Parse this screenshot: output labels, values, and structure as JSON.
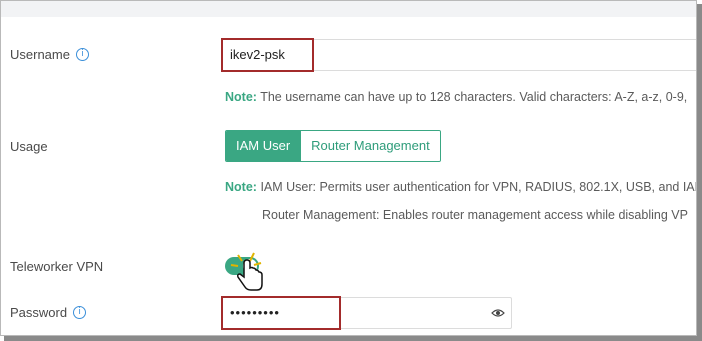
{
  "fields": {
    "username": {
      "label": "Username",
      "value": "ikev2-psk"
    },
    "username_note": {
      "prefix": "Note:",
      "text": "The username can have up to 128 characters. Valid characters: A-Z, a-z, 0-9,"
    },
    "usage": {
      "label": "Usage",
      "options": [
        "IAM User",
        "Router Management"
      ],
      "selected": "IAM User"
    },
    "usage_note": {
      "prefix": "Note:",
      "line1": "IAM User: Permits user authentication for VPN, RADIUS, 802.1X, USB, and IAM",
      "line2": "Router Management: Enables router management access while disabling VP"
    },
    "teleworker": {
      "label": "Teleworker VPN",
      "enabled": true
    },
    "password": {
      "label": "Password",
      "value": "•••••••••"
    }
  },
  "icons": {
    "info": "info-icon",
    "eye": "eye-icon",
    "cursor": "hand-pointer-icon"
  },
  "colors": {
    "accent": "#3aa783",
    "highlight": "#a32b2b",
    "info": "#3b8fd9"
  }
}
